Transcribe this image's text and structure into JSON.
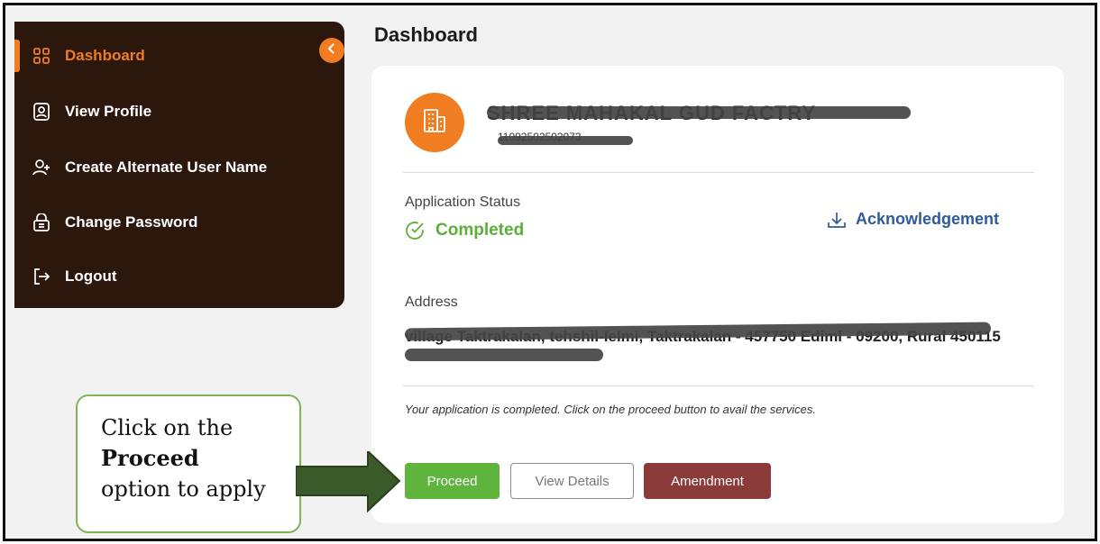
{
  "sidebar": {
    "items": [
      {
        "label": "Dashboard",
        "icon": "grid-icon",
        "active": true
      },
      {
        "label": "View Profile",
        "icon": "profile-icon"
      },
      {
        "label": "Create Alternate User Name",
        "icon": "add-user-icon"
      },
      {
        "label": "Change Password",
        "icon": "lock-icon"
      },
      {
        "label": "Logout",
        "icon": "logout-icon"
      }
    ],
    "collapse_icon": "chevron-left-icon"
  },
  "page_title": "Dashboard",
  "card": {
    "org_name": "SHREE MAHAKAL GUD FACTRY",
    "org_id": "11092502502073",
    "application_status_label": "Application Status",
    "status": "Completed",
    "acknowledgement_label": "Acknowledgement",
    "address_label": "Address",
    "address_value": "village Taktrakalan, tehshil-Ielmi, Taktrakalan - 457750 Ediml - 09200, Rural 450115",
    "note": "Your application is completed. Click on the proceed button to avail the services.",
    "buttons": {
      "proceed": "Proceed",
      "view_details": "View Details",
      "amendment": "Amendment"
    }
  },
  "callout": {
    "line1": "Click on the",
    "line2": "Proceed",
    "line3": "option to apply"
  },
  "colors": {
    "sidebar_bg": "#2c170c",
    "accent": "#f07d22",
    "success": "#5fb43e",
    "link": "#2f5a9e",
    "amend": "#8c3b3b"
  }
}
